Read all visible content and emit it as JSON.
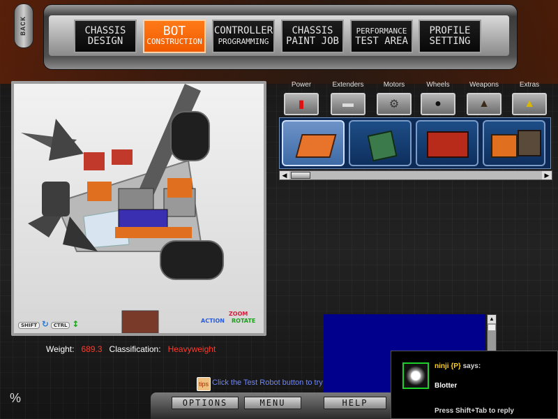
{
  "back_label": "BACK",
  "nav": {
    "tabs": [
      {
        "line1": "CHASSIS",
        "line2": "DESIGN",
        "active": false
      },
      {
        "line1": "BOT",
        "line2": "CONSTRUCTION",
        "active": true
      },
      {
        "line1": "CONTROLLER",
        "line2": "PROGRAMMING",
        "active": false
      },
      {
        "line1": "CHASSIS",
        "line2": "PAINT JOB",
        "active": false
      },
      {
        "line1": "PERFORMANCE",
        "line2": "TEST AREA",
        "active": false
      },
      {
        "line1": "PROFILE",
        "line2": "SETTING",
        "active": false
      }
    ]
  },
  "viewport": {
    "controls": {
      "shift": "SHIFT",
      "ctrl": "CTRL",
      "action": "ACTION",
      "zoom": "ZOOM",
      "rotate": "ROTATE"
    }
  },
  "parts": {
    "categories": [
      "Power",
      "Extenders",
      "Motors",
      "Wheels",
      "Weapons",
      "Extras"
    ],
    "category_icons": [
      "battery-icon",
      "extender-bar-icon",
      "motor-icon",
      "wheel-icon",
      "weapon-icon",
      "extras-icon"
    ]
  },
  "stats": {
    "weight_label": "Weight:",
    "weight_value": "689.3",
    "class_label": "Classification:",
    "class_value": "Heavyweight"
  },
  "tip": {
    "icon_text": "tips",
    "text": "Click the Test Robot button to try out your robot."
  },
  "bottom": {
    "options": "OPTIONS",
    "menu": "MENU",
    "help": "HELP"
  },
  "chat": {
    "sender": "ninji {P}",
    "says": "says:",
    "message": "Blotter",
    "hint": "Press Shift+Tab to reply"
  },
  "colors": {
    "accent": "#f05a00",
    "stat_value": "#ff3a2a",
    "tip_text": "#6f86ff",
    "chat_name": "#ffd21a",
    "avatar_border": "#1bd12a"
  }
}
